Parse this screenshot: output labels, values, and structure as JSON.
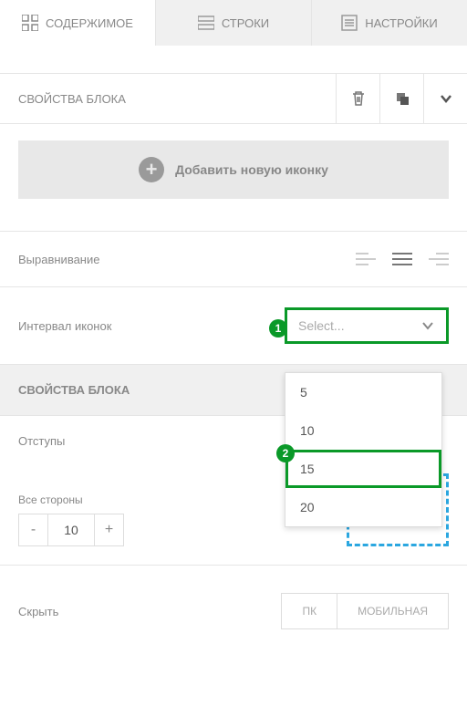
{
  "tabs": {
    "content": "СОДЕРЖИМОЕ",
    "rows": "СТРОКИ",
    "settings": "НАСТРОЙКИ"
  },
  "blockProps": {
    "title": "СВОЙСТВА БЛОКА"
  },
  "addIcon": {
    "label": "Добавить новую иконку"
  },
  "alignment": {
    "label": "Выравнивание"
  },
  "iconSpacing": {
    "label": "Интервал иконок",
    "placeholder": "Select...",
    "options": [
      "5",
      "10",
      "15",
      "20"
    ]
  },
  "blockProps2": {
    "title": "СВОЙСТВА БЛОКА"
  },
  "padding": {
    "label": "Отступы",
    "allSides": "Все стороны",
    "value": "10"
  },
  "hide": {
    "label": "Скрыть",
    "pc": "ПК",
    "mobile": "МОБИЛЬНАЯ"
  },
  "annotations": {
    "one": "1",
    "two": "2"
  }
}
